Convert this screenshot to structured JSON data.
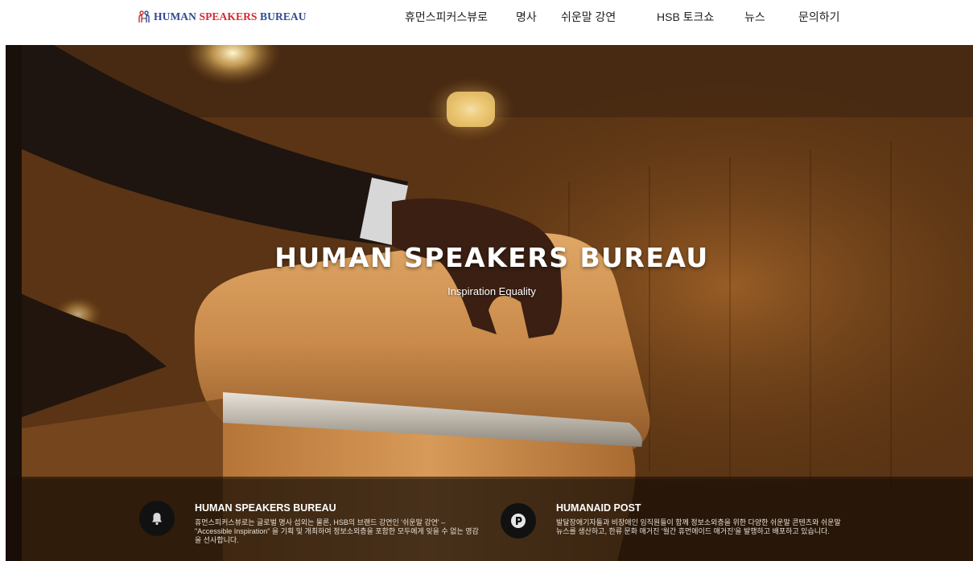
{
  "header": {
    "logo": {
      "part1": "HUMAN ",
      "part2": "SPEAKERS",
      "part3": " BUREAU"
    },
    "nav": [
      {
        "label": "휴먼스피커스뷰로"
      },
      {
        "label": "명사"
      },
      {
        "label": "쉬운말 강연"
      },
      {
        "label": "HSB 토크쇼"
      },
      {
        "label": "뉴스"
      },
      {
        "label": "문의하기"
      }
    ]
  },
  "hero": {
    "title": "HUMAN SPEAKERS BUREAU",
    "subtitle": "Inspiration Equality"
  },
  "info": [
    {
      "icon": "bell-icon",
      "title": "HUMAN SPEAKERS BUREAU",
      "text": "휴먼스피커스뷰로는 글로벌 명사 섭외는 물론, HSB의 브랜드 강연인 '쉬운말 강연' – \"Accessible Inspiration\" 을 기획 및 개최하여 정보소외층을 포함한 모두에게 잊을 수 없는 영감을 선사합니다."
    },
    {
      "icon": "p-circle-icon",
      "title": "HUMANAID POST",
      "text": "발달장애기자들과 비장애인 임직원들이 함께 정보소외층을 위한 다양한 쉬운말 콘텐츠와 쉬운말 뉴스를 생산하고, 한류 문화 매거진 '월간 휴먼에이드 매거진'을 발행하고 배포하고 있습니다."
    }
  ],
  "colors": {
    "logo_blue": "#2f4a8f",
    "logo_red": "#d6282e",
    "nav_text": "#222222",
    "icon_circle": "#111111"
  }
}
